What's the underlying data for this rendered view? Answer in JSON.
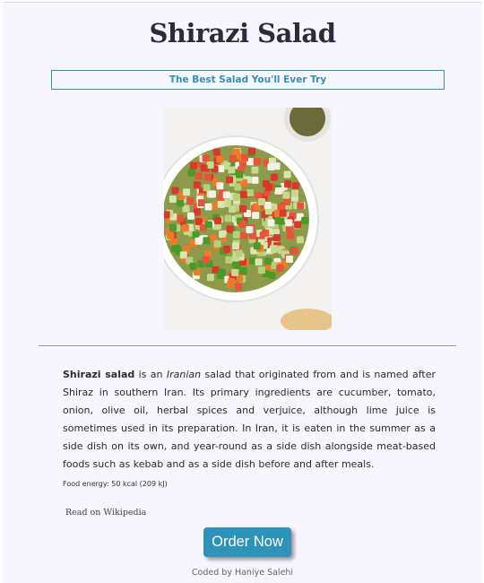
{
  "title": "Shirazi Salad",
  "subtitle": "The Best Salad You'll Ever Try",
  "description": {
    "bold": "Shirazi salad",
    "part1": " is an ",
    "italic": "Iranian",
    "part2": " salad that originated from and is named after Shiraz in southern Iran. Its primary ingredients are cucumber, tomato, onion, olive oil, herbal spices and verjuice, although lime juice is sometimes used in its preparation. In Iran, it is eaten in the summer as a side dish on its own, and year-round as a side dish alongside meat-based foods such as kebab and as a side dish before and after meals."
  },
  "energy": "Food energy: 50 kcal (209 kJ)",
  "wiki_link": "Read on Wikipedia",
  "order_button": "Order Now",
  "credit": "Coded by Haniye Salehi",
  "colors": {
    "accent": "#2e93b8",
    "background": "#f7f5fd",
    "title": "#2e2a3e"
  }
}
